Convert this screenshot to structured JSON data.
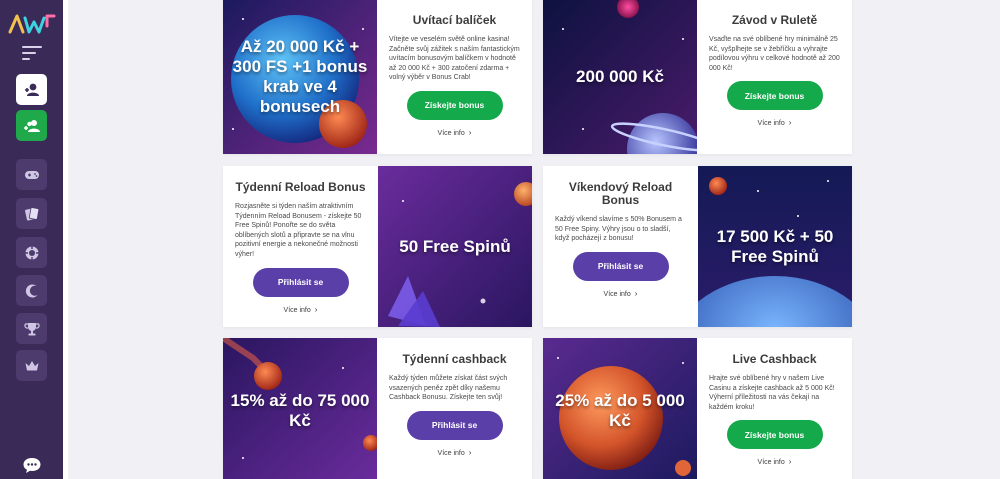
{
  "sidebar": {
    "logo_alt": "AW",
    "items": [
      {
        "name": "login-button",
        "icon": "user-icon"
      },
      {
        "name": "register-button",
        "icon": "add-user-icon"
      },
      {
        "name": "games-nav",
        "icon": "gamepad-icon"
      },
      {
        "name": "cards-nav",
        "icon": "cards-icon"
      },
      {
        "name": "poker-chip-nav",
        "icon": "chip-icon"
      },
      {
        "name": "promotions-nav",
        "icon": "moon-icon"
      },
      {
        "name": "tournament-nav",
        "icon": "trophy-icon"
      },
      {
        "name": "vip-nav",
        "icon": "crown-icon"
      }
    ],
    "chat_icon": "chat-icon"
  },
  "colors": {
    "sidebar_bg": "#3a2a58",
    "green": "#14a94a",
    "purple": "#5b3fa8",
    "page_bg": "#f1f1f5"
  },
  "more_label": "Více info",
  "promos": [
    {
      "image_text": "Až 20 000 Kč + 300 FS +1 bonus krab ve 4 bonusech",
      "title": "Uvítací balíček",
      "description": "Vítejte ve veselém světě online kasina! Začněte svůj zážitek s naším fantastickým uvítacím bonusovým balíčkem v hodnotě až 20 000 Kč + 300 zatočení zdarma + volný výběr v Bonus Crab!",
      "button": "Získejte bonus"
    },
    {
      "image_text": "200 000 Kč",
      "title": "Závod v Ruletě",
      "description": "Vsaďte na své oblíbené hry minimálně 25 Kč, vyšplhejte se v žebříčku a vyhrajte podílovou výhru v celkové hodnotě až 200 000 Kč!",
      "button": "Získejte bonus"
    },
    {
      "image_text": "50 Free Spinů",
      "title": "Týdenní Reload Bonus",
      "description": "Rozjasněte si týden naším atraktivním Týdenním Reload Bonusem - získejte 50 Free Spinů! Ponořte se do světa oblíbených slotů a připravte se na vlnu pozitivní energie a nekonečné možnosti výher!",
      "button": "Přihlásit se"
    },
    {
      "image_text": "17 500 Kč + 50 Free Spinů",
      "title": "Víkendový Reload Bonus",
      "description": "Každý víkend slavíme s 50% Bonusem a 50 Free Spiny. Výhry jsou o to sladší, když pocházejí z bonusu!",
      "button": "Přihlásit se"
    },
    {
      "image_text": "15% až do 75 000 Kč",
      "title": "Týdenní cashback",
      "description": "Každý týden můžete získat část svých vsazených peněz zpět díky našemu Cashback Bonusu. Získejte ten svůj!",
      "button": "Přihlásit se"
    },
    {
      "image_text": "25% až do 5 000 Kč",
      "title": "Live Cashback",
      "description": "Hrajte své oblíbené hry v našem Live Casinu a získejte cashback až 5 000 Kč! Výherní příležitosti na vás čekají na každém kroku!",
      "button": "Získejte bonus"
    }
  ]
}
